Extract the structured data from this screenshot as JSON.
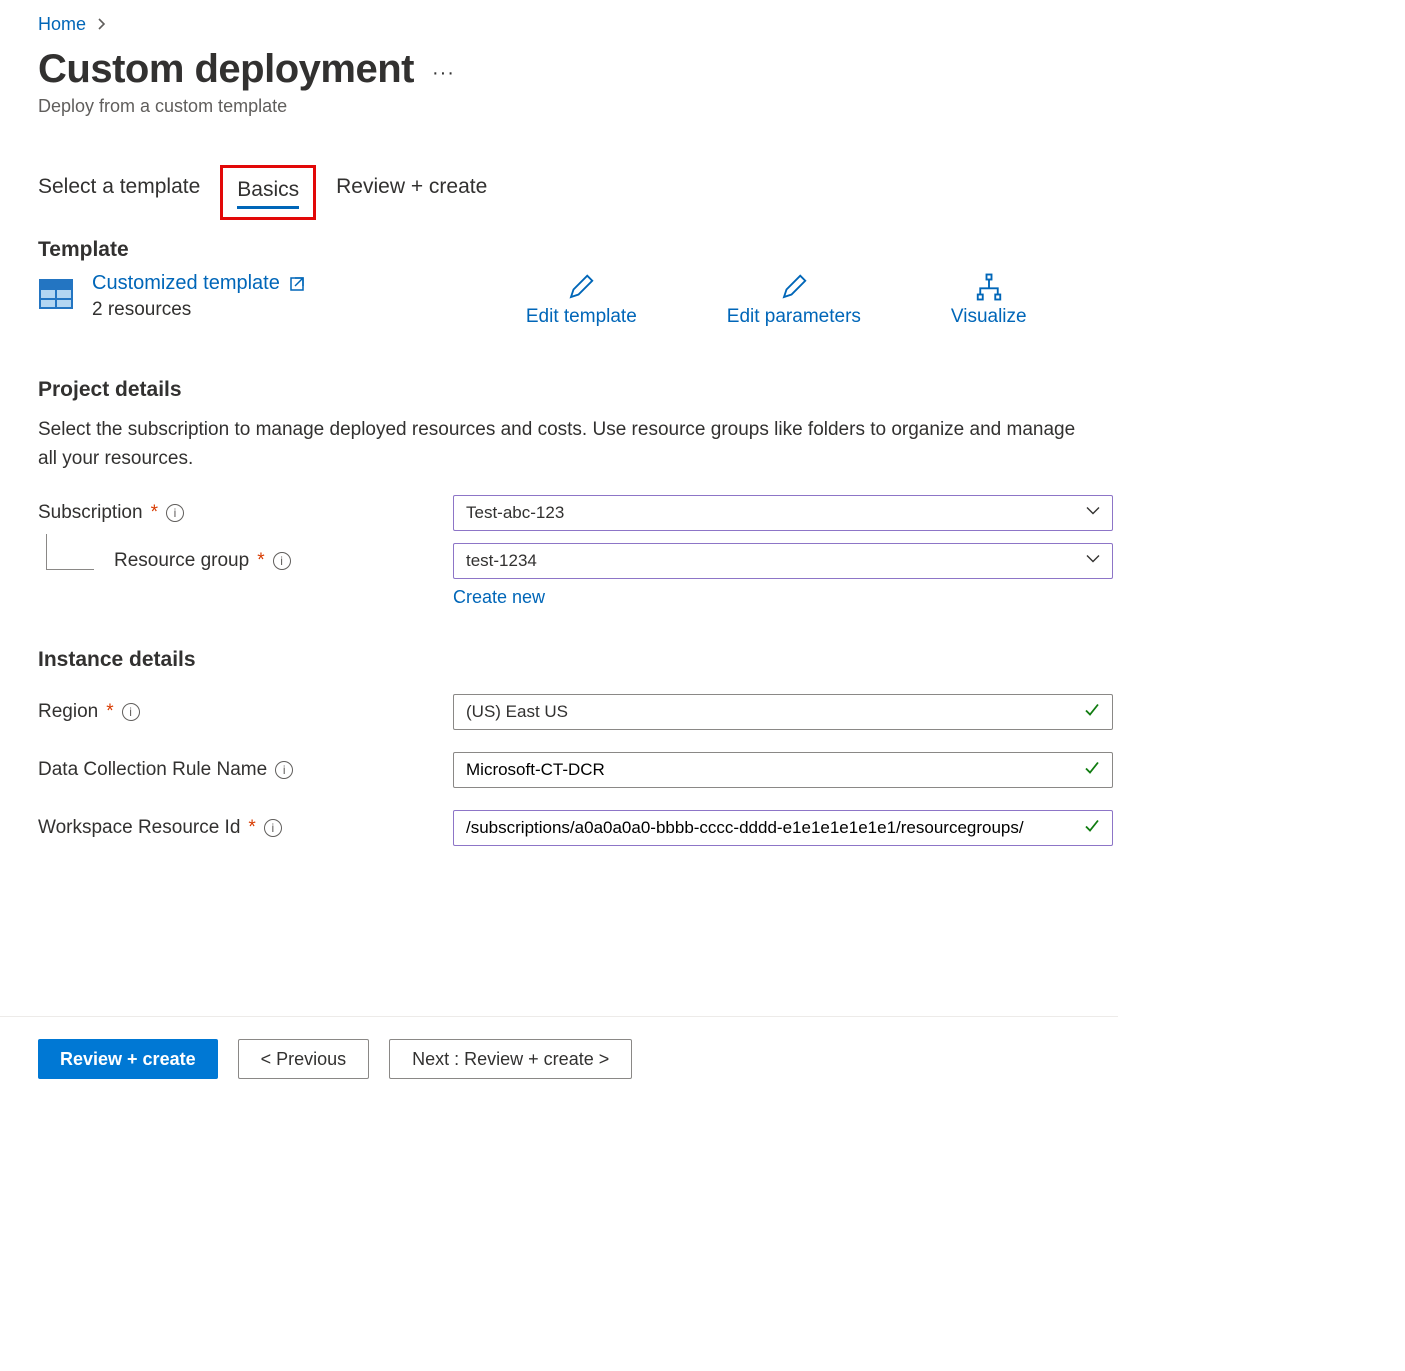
{
  "breadcrumb": {
    "home": "Home"
  },
  "header": {
    "title": "Custom deployment",
    "subtitle": "Deploy from a custom template"
  },
  "tabs": {
    "select_template": "Select a template",
    "basics": "Basics",
    "review_create": "Review + create"
  },
  "template": {
    "heading": "Template",
    "link": "Customized template",
    "resources": "2 resources",
    "edit_template": "Edit template",
    "edit_parameters": "Edit parameters",
    "visualize": "Visualize"
  },
  "project_details": {
    "heading": "Project details",
    "description": "Select the subscription to manage deployed resources and costs. Use resource groups like folders to organize and manage all your resources.",
    "subscription_label": "Subscription",
    "subscription_value": "Test-abc-123",
    "resource_group_label": "Resource group",
    "resource_group_value": "test-1234",
    "create_new": "Create new"
  },
  "instance_details": {
    "heading": "Instance details",
    "region_label": "Region",
    "region_value": "(US) East US",
    "dcr_label": "Data Collection Rule Name",
    "dcr_value": "Microsoft-CT-DCR",
    "workspace_label": "Workspace Resource Id",
    "workspace_value": "/subscriptions/a0a0a0a0-bbbb-cccc-dddd-e1e1e1e1e1e1/resourcegroups/"
  },
  "footer": {
    "review_create": "Review + create",
    "previous": "< Previous",
    "next": "Next : Review + create >"
  }
}
